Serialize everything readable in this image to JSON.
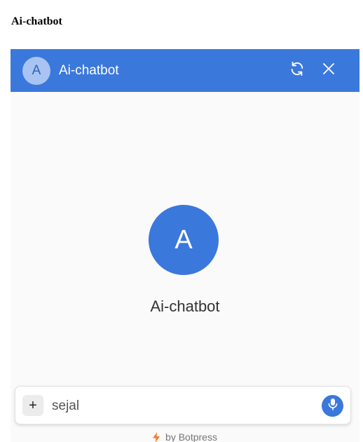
{
  "page": {
    "heading": "Ai-chatbot"
  },
  "header": {
    "avatar_letter": "A",
    "title": "Ai-chatbot",
    "refresh_icon": "refresh-icon",
    "close_icon": "close-icon"
  },
  "main": {
    "avatar_letter": "A",
    "bot_name": "Ai-chatbot"
  },
  "composer": {
    "plus_label": "+",
    "input_value": "sejal",
    "mic_icon": "microphone-icon"
  },
  "footer": {
    "text": "by Botpress",
    "icon": "bolt-icon"
  },
  "colors": {
    "accent": "#3b78dc",
    "header_avatar_bg": "#a9c4f2",
    "bolt": "#f07d2a"
  }
}
